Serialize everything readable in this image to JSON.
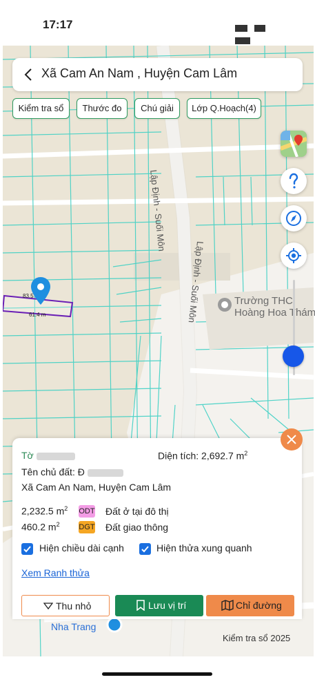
{
  "status_bar": {
    "time": "17:17"
  },
  "header": {
    "title": "Xã Cam An Nam , Huyện Cam Lâm"
  },
  "toolbar": {
    "chips": [
      "Kiểm tra sổ",
      "Thước đo",
      "Chú giải",
      "Lớp Q.Hoạch(4)"
    ]
  },
  "map": {
    "roads": [
      "Lập Định - Suối Môn",
      "Lập Định - Suối Môn"
    ],
    "poi": [
      "Trường THC",
      "Hoàng Hoa Thám"
    ],
    "parcel": {
      "edge_top": "83.5",
      "edge_bottom": "61.4 m"
    },
    "footer_left": "Nha Trang",
    "footer_right": "Kiểm tra sổ 2025",
    "colors": {
      "parcel_outline": "#6a1fb5",
      "plot_lines": "#3fd0c4",
      "marker": "#1f8fe0"
    }
  },
  "panel": {
    "to_label": "Tờ",
    "area_label": "Diện tích: 2,692.7 m",
    "area_sup": "2",
    "owner_label": "Tên chủ đất: Đ",
    "address": "Xã Cam An Nam, Huyện Cam Lâm",
    "land_uses": [
      {
        "area": "2,232.5 m",
        "sup": "2",
        "code": "ODT",
        "code_color": "#f39ce5",
        "name": "Đất ở tại đô thị"
      },
      {
        "area": "460.2 m",
        "sup": "2",
        "code": "DGT",
        "code_color": "#f5a623",
        "name": "Đất giao thông"
      }
    ],
    "options": [
      {
        "label": "Hiện chiều dài cạnh",
        "checked": true
      },
      {
        "label": "Hiện thửa xung quanh",
        "checked": true
      }
    ],
    "link": "Xem Ranh thửa",
    "buttons": {
      "shrink": "Thu nhỏ",
      "save": "Lưu vị trí",
      "directions": "Chỉ đường"
    },
    "button_colors": {
      "save": "#1a8a55",
      "directions": "#ef8a4a"
    }
  }
}
